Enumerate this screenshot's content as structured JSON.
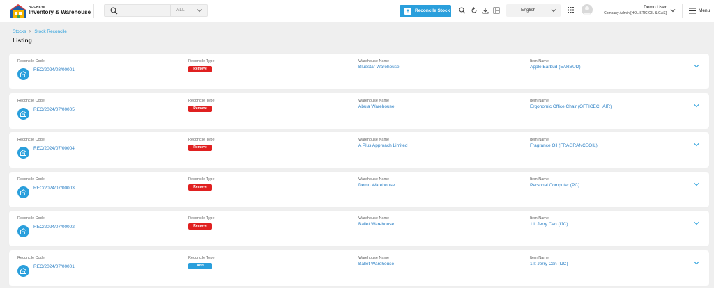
{
  "brand": {
    "small": "ROCKEYE",
    "title": "Inventory & Warehouse"
  },
  "search": {
    "placeholder": "",
    "filter": "ALL"
  },
  "header": {
    "reconcile_button": "Reconcile Stock",
    "language": "English",
    "user_name": "Demo User",
    "user_role": "Company Admin [HOLISTIC OIL & GAS]",
    "menu_label": "Menu"
  },
  "breadcrumb": {
    "parent": "Stocks",
    "sep": ">",
    "current": "Stock Reconcile"
  },
  "page_title": "Listing",
  "labels": {
    "code": "Reconcile Code",
    "type": "Reconcile Type",
    "warehouse": "Warehouse Name",
    "item": "Item Name"
  },
  "colors": {
    "accent": "#2a9fdc",
    "remove": "#e02020",
    "add": "#2a9fdc",
    "link": "#2a7fc4"
  },
  "records": [
    {
      "code": "REC/2024/08/00001",
      "type": "Remove",
      "warehouse": "Bluestar Warehouse",
      "item": "Apple Earbud (EARBUD)"
    },
    {
      "code": "REC/2024/07/00005",
      "type": "Remove",
      "warehouse": "Abuja Warehouse",
      "item": "Ergonomic Office Chair (OFFICECHAIR)"
    },
    {
      "code": "REC/2024/07/00004",
      "type": "Remove",
      "warehouse": "A Plus Approach Limited",
      "item": "Fragrance Oil (FRAGRANCEOIL)"
    },
    {
      "code": "REC/2024/07/00003",
      "type": "Remove",
      "warehouse": "Demo Warehouse",
      "item": "Personal Computer (PC)"
    },
    {
      "code": "REC/2024/07/00002",
      "type": "Remove",
      "warehouse": "Ballet Warehouse",
      "item": "1 lt Jerry Can (IJC)"
    },
    {
      "code": "REC/2024/07/00001",
      "type": "Add",
      "warehouse": "Ballet Warehouse",
      "item": "1 lt Jerry Can (IJC)"
    }
  ]
}
